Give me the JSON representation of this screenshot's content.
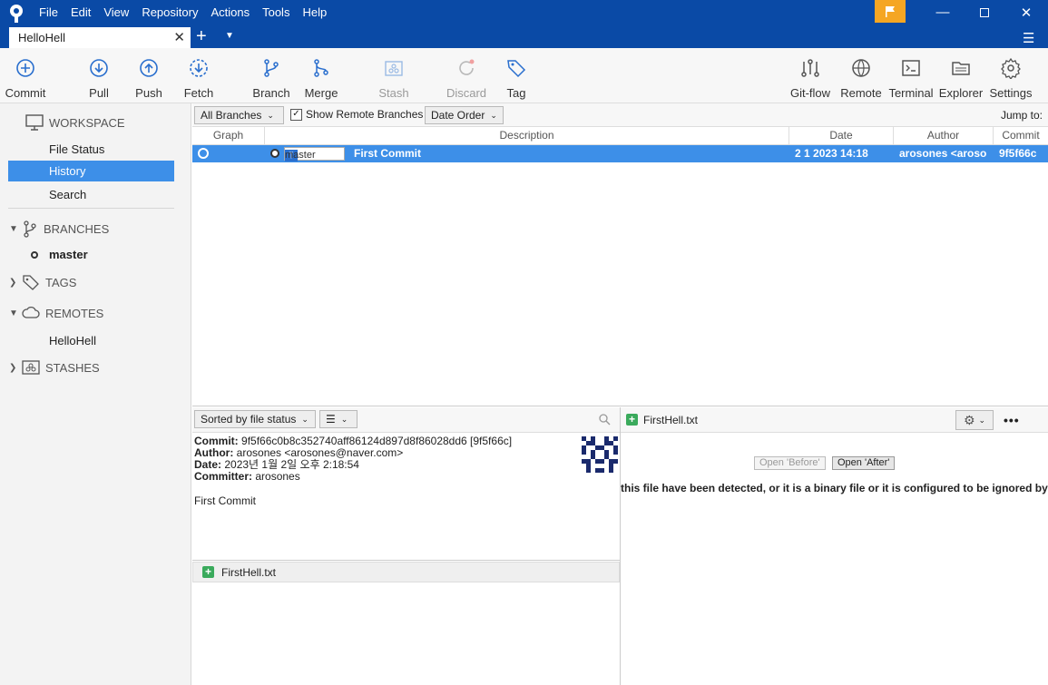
{
  "menu": [
    "File",
    "Edit",
    "View",
    "Repository",
    "Actions",
    "Tools",
    "Help"
  ],
  "repo_tab": {
    "title": "HelloHell"
  },
  "toolbar": {
    "commit": "Commit",
    "pull": "Pull",
    "push": "Push",
    "fetch": "Fetch",
    "branch": "Branch",
    "merge": "Merge",
    "stash": "Stash",
    "discard": "Discard",
    "tag": "Tag",
    "gitflow": "Git-flow",
    "remote": "Remote",
    "terminal": "Terminal",
    "explorer": "Explorer",
    "settings": "Settings"
  },
  "sidebar": {
    "workspace": "WORKSPACE",
    "file_status": "File Status",
    "history": "History",
    "search": "Search",
    "branches": "BRANCHES",
    "branch_master": "master",
    "tags": "TAGS",
    "remotes": "REMOTES",
    "remote_hellohell": "HelloHell",
    "stashes": "STASHES"
  },
  "filters": {
    "branches": "All Branches",
    "show_remote": "Show Remote Branches",
    "order": "Date Order",
    "jump_to": "Jump to:"
  },
  "history": {
    "columns": {
      "graph": "Graph",
      "description": "Description",
      "date": "Date",
      "author": "Author",
      "commit": "Commit"
    },
    "rows": [
      {
        "branch_tag": "master",
        "description": "First Commit",
        "date": "2 1 2023 14:18",
        "author": "arosones <aroso",
        "commit": "9f5f66c"
      }
    ]
  },
  "details": {
    "sort": "Sorted by file status",
    "commit_label": "Commit:",
    "commit_value": "9f5f66c0b8c352740aff86124d897d8f86028dd6 [9f5f66c]",
    "author_label": "Author:",
    "author_value": "arosones <arosones@naver.com>",
    "date_label": "Date:",
    "date_value": "2023년 1월 2일 오후 2:18:54",
    "committer_label": "Committer:",
    "committer_value": "arosones",
    "message": "First Commit",
    "file": "FirstHell.txt"
  },
  "diff": {
    "file": "FirstHell.txt",
    "open_before": "Open 'Before'",
    "open_after": "Open 'After'",
    "note": "this file have been detected, or it is a binary file or it is configured to be ignored by t"
  },
  "colors": {
    "titlebar": "#0a4aa6",
    "selection": "#3d8fe8",
    "flag": "#f5a623",
    "added": "#3aaa5c"
  }
}
